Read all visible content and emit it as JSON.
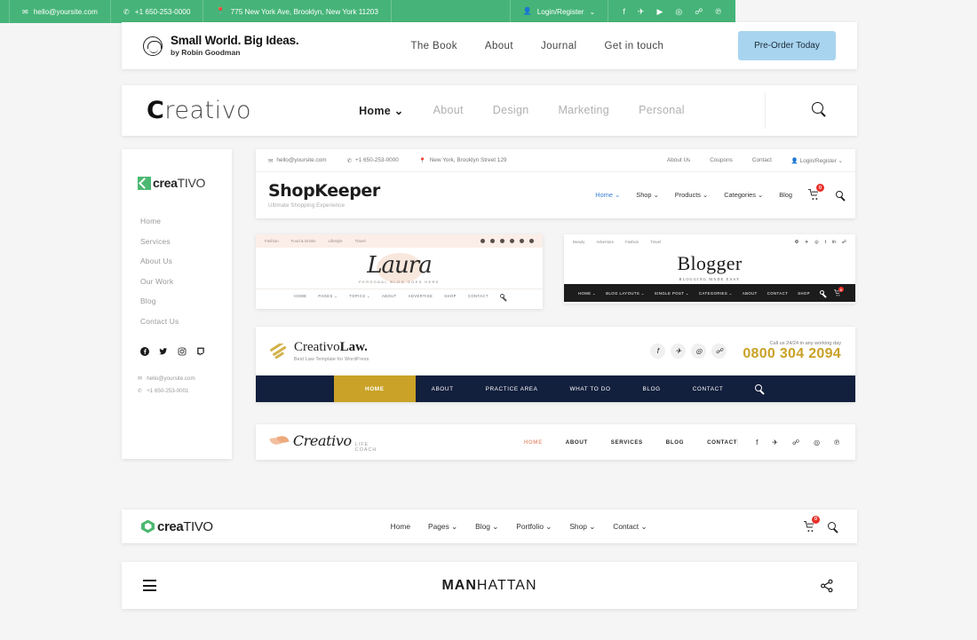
{
  "small_world_header": {
    "logo_icon": "globe-hand-icon",
    "brand_title": "Small World. Big Ideas.",
    "brand_subtitle": "by Robin Goodman",
    "nav": [
      "The Book",
      "About",
      "Journal",
      "Get in touch"
    ],
    "cta_label": "Pre-Order Today",
    "cta_color": "#a8d4f0"
  },
  "creativo_header": {
    "logo_bold": "C",
    "logo_rest": "reativo",
    "nav": [
      {
        "label": "Home",
        "active": true,
        "caret": true
      },
      {
        "label": "About",
        "active": false,
        "caret": false
      },
      {
        "label": "Design",
        "active": false,
        "caret": false
      },
      {
        "label": "Marketing",
        "active": false,
        "caret": false
      },
      {
        "label": "Personal",
        "active": false,
        "caret": false
      }
    ],
    "search_icon": "search-icon"
  },
  "sidebar": {
    "logo_bold": "crea",
    "logo_light": "TIVO",
    "logo_mark_color": "#4cb872",
    "items": [
      "Home",
      "Services",
      "About Us",
      "Our Work",
      "Blog",
      "Contact Us"
    ],
    "socials": [
      "facebook-icon",
      "twitter-icon",
      "instagram-icon",
      "twitch-icon"
    ],
    "email": "hello@yoursite.com",
    "phone": "+1 650-253-0001"
  },
  "shopkeeper": {
    "topbar": {
      "email": "hello@yoursite.com",
      "phone": "+1 650-253-0000",
      "address": "New York, Brooklyn Street 129",
      "links": [
        "About Us",
        "Coupons",
        "Contact"
      ],
      "account": "Login/Register"
    },
    "title": "ShopKeeper",
    "subtitle": "Ultimate Shopping Experience",
    "nav": [
      {
        "label": "Home",
        "active": true,
        "caret": true
      },
      {
        "label": "Shop",
        "active": false,
        "caret": true
      },
      {
        "label": "Products",
        "active": false,
        "caret": true
      },
      {
        "label": "Categories",
        "active": false,
        "caret": true
      },
      {
        "label": "Blog",
        "active": false,
        "caret": false
      }
    ],
    "cart_count": "0",
    "search_icon": "search-icon"
  },
  "laura": {
    "topbar_links": [
      "Fashion",
      "Food & Drinks",
      "Lifestyle",
      "Travel"
    ],
    "brand": "Laura",
    "tagline": "PERSONAL BLOG GOES HERE",
    "nav": [
      "HOME",
      "PAGES",
      "TOPICS",
      "ABOUT",
      "ADVERTISE",
      "SHOP",
      "CONTACT"
    ],
    "bg_color": "#fbeee8"
  },
  "blogger": {
    "topbar_links": [
      "Beauty",
      "Adventure",
      "Fashion",
      "Travel"
    ],
    "brand": "Blogger",
    "tagline": "BLOGGING MADE EASY",
    "nav": [
      "HOME",
      "BLOG LAYOUTS",
      "SINGLE POST",
      "CATEGORIES",
      "ABOUT",
      "CONTACT",
      "SHOP"
    ],
    "cart_count": "0",
    "nav_bg": "#1c1c1c"
  },
  "creativo_law": {
    "brand_light": "Creativo",
    "brand_bold": "Law.",
    "subtitle": "Best Law Template for WordPress",
    "socials": [
      "facebook-icon",
      "twitter-icon",
      "instagram-icon",
      "twitch-icon"
    ],
    "call_note": "Call us 24/24 in any working day",
    "phone": "0800 304 2094",
    "nav": [
      "HOME",
      "ABOUT",
      "PRACTICE AREA",
      "WHAT TO DO",
      "BLOG",
      "CONTACT"
    ],
    "nav_bg": "#121f3d",
    "accent": "#c9a227"
  },
  "life_coach": {
    "brand": "Creativo",
    "tagline": "LIFE COACH",
    "nav": [
      "HOME",
      "ABOUT",
      "SERVICES",
      "BLOG",
      "CONTACT"
    ],
    "active_nav": "HOME",
    "accent": "#e89b85",
    "socials": [
      "facebook-icon",
      "twitter-icon",
      "twitch-icon",
      "instagram-icon",
      "pinterest-icon"
    ]
  },
  "green_bar": {
    "email": "hello@yoursite.com",
    "phone": "+1 650-253-0000",
    "address": "775 New York Ave, Brooklyn, New York 11203",
    "account": "Login/Register",
    "socials": [
      "facebook-icon",
      "twitter-icon",
      "youtube-icon",
      "instagram-icon",
      "twitch-icon",
      "pinterest-icon"
    ],
    "bg_color": "#46b478"
  },
  "creativo_shop_nav": {
    "logo_bold": "crea",
    "logo_light": "TIVO",
    "nav": [
      {
        "label": "Home",
        "caret": false
      },
      {
        "label": "Pages",
        "caret": true
      },
      {
        "label": "Blog",
        "caret": true
      },
      {
        "label": "Portfolio",
        "caret": true
      },
      {
        "label": "Shop",
        "caret": true
      },
      {
        "label": "Contact",
        "caret": true
      }
    ],
    "cart_count": "0",
    "search_icon": "search-icon"
  },
  "manhattan": {
    "menu_icon": "hamburger-icon",
    "brand_bold": "MAN",
    "brand_light": "HATTAN",
    "share_icon": "share-icon"
  }
}
